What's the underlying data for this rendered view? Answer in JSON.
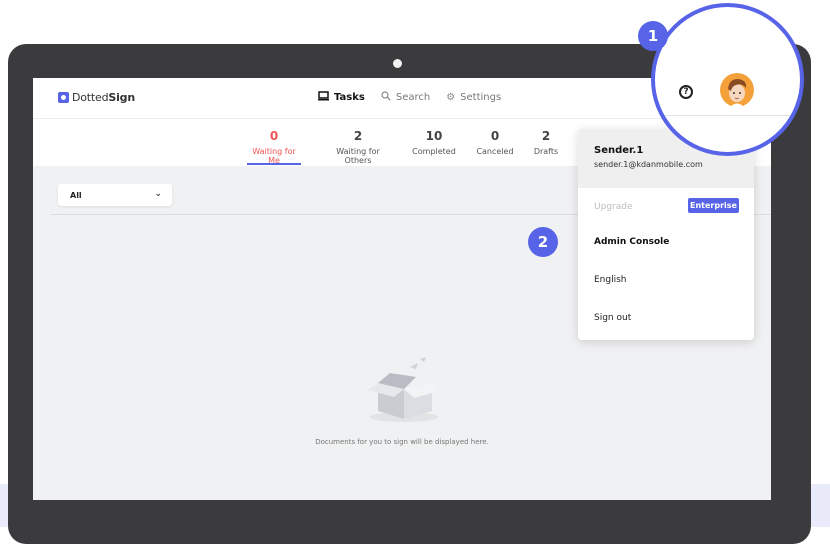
{
  "brand": {
    "logo_prefix": "Dotted",
    "logo_suffix": "Sign"
  },
  "nav": {
    "tasks": "Tasks",
    "search": "Search",
    "settings": "Settings"
  },
  "tabs": [
    {
      "count": "0",
      "label": "Waiting for Me"
    },
    {
      "count": "2",
      "label": "Waiting for Others"
    },
    {
      "count": "10",
      "label": "Completed"
    },
    {
      "count": "0",
      "label": "Canceled"
    },
    {
      "count": "2",
      "label": "Drafts"
    }
  ],
  "filter": {
    "value": "All"
  },
  "empty_state": {
    "message": "Documents for you to sign will be displayed here."
  },
  "account_menu": {
    "name": "Sender.1",
    "email": "sender.1@kdanmobile.com",
    "upgrade": "Upgrade",
    "plan_badge": "Enterprise",
    "admin_console": "Admin Console",
    "language": "English",
    "sign_out": "Sign out"
  },
  "callouts": {
    "step1": "1",
    "step2": "2"
  },
  "colors": {
    "accent": "#5864e8",
    "active_tab": "#ef5454",
    "laptop": "#3b3b3d"
  },
  "icons": {
    "tasks": "monitor-icon",
    "search": "search-icon",
    "settings": "gear-icon",
    "help": "help-icon"
  }
}
